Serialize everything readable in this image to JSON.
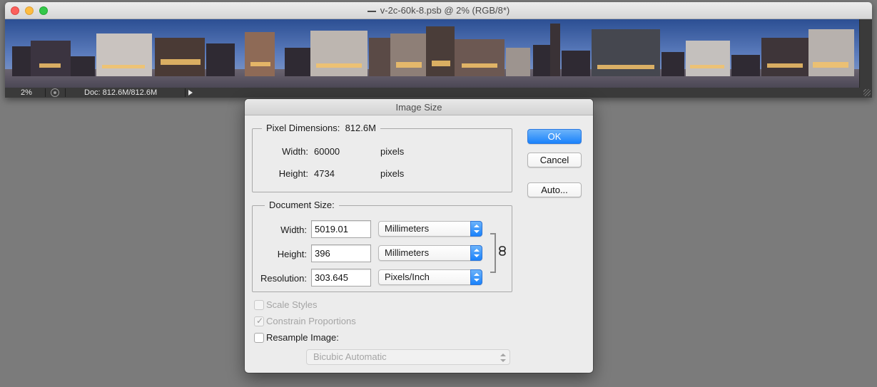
{
  "document_window": {
    "title": "v-2c-60k-8.psb @ 2% (RGB/8*)",
    "status": {
      "zoom": "2%",
      "doc_size": "Doc: 812.6M/812.6M"
    }
  },
  "dialog": {
    "title": "Image Size",
    "pixel_dimensions": {
      "legend": "Pixel Dimensions:",
      "size": "812.6M",
      "width_label": "Width:",
      "width_value": "60000",
      "width_unit": "pixels",
      "height_label": "Height:",
      "height_value": "4734",
      "height_unit": "pixels"
    },
    "document_size": {
      "legend": "Document Size:",
      "width_label": "Width:",
      "width_value": "5019.01",
      "width_unit": "Millimeters",
      "height_label": "Height:",
      "height_value": "396",
      "height_unit": "Millimeters",
      "resolution_label": "Resolution:",
      "resolution_value": "303.645",
      "resolution_unit": "Pixels/Inch"
    },
    "buttons": {
      "ok": "OK",
      "cancel": "Cancel",
      "auto": "Auto..."
    },
    "options": {
      "scale_styles": "Scale Styles",
      "constrain_proportions": "Constrain Proportions",
      "resample_image": "Resample Image:",
      "resample_method": "Bicubic Automatic"
    }
  },
  "colors": {
    "accent": "#1a82fb",
    "workspace": "#7b7b7b",
    "dialog_bg": "#ececec"
  }
}
